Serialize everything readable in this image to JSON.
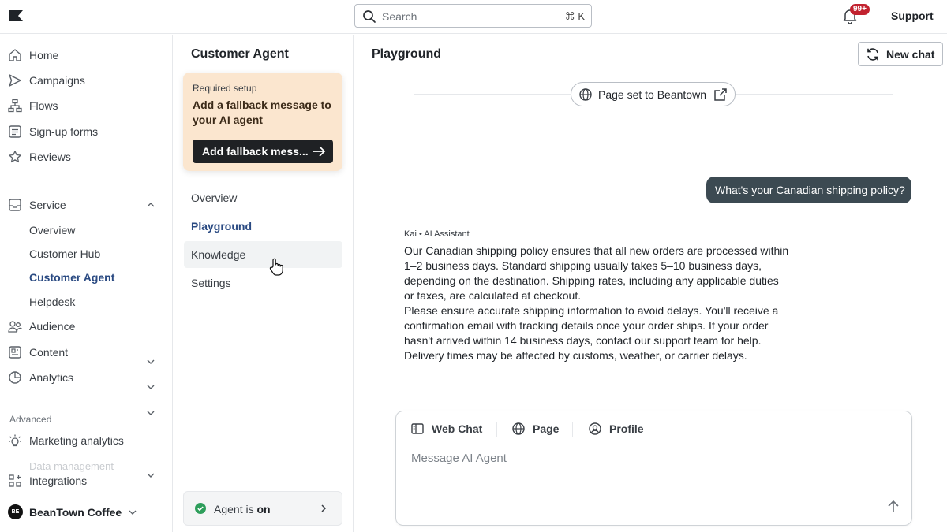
{
  "topbar": {
    "search_placeholder": "Search",
    "search_shortcut": "⌘ K",
    "notifications_badge": "99+",
    "support_label": "Support"
  },
  "sidebar": {
    "items": [
      {
        "label": "Home",
        "icon": "home-icon"
      },
      {
        "label": "Campaigns",
        "icon": "send-icon"
      },
      {
        "label": "Flows",
        "icon": "flows-icon"
      },
      {
        "label": "Sign-up forms",
        "icon": "form-icon"
      },
      {
        "label": "Reviews",
        "icon": "star-icon"
      }
    ],
    "service": {
      "label": "Service",
      "expanded": true,
      "children": [
        "Overview",
        "Customer Hub",
        "Customer Agent",
        "Helpdesk"
      ],
      "active": "Customer Agent"
    },
    "collapsed_groups": [
      {
        "label": "Audience",
        "icon": "audience-icon"
      },
      {
        "label": "Content",
        "icon": "content-icon"
      },
      {
        "label": "Analytics",
        "icon": "analytics-icon"
      }
    ],
    "advanced_section": "Advanced",
    "advanced_items": [
      {
        "label": "Marketing analytics",
        "icon": "bulb-icon"
      },
      {
        "label": "Data management",
        "icon": "data-icon"
      }
    ],
    "integrations": "Integrations",
    "account": {
      "initials": "BE",
      "name": "BeanTown Coffee"
    }
  },
  "agent_panel": {
    "title": "Customer Agent",
    "setup_card": {
      "kicker": "Required setup",
      "title": "Add a fallback message to your AI agent",
      "button": "Add fallback mess..."
    },
    "tabs": [
      "Overview",
      "Playground",
      "Knowledge",
      "Settings"
    ],
    "active_tab": "Playground",
    "status": {
      "prefix": "Agent is ",
      "state": "on"
    }
  },
  "main": {
    "title": "Playground",
    "new_chat": "New chat",
    "page_set": "Page set to Beantown",
    "user_message": "What's your Canadian shipping policy?",
    "assistant": {
      "meta": "Kai • AI Assistant",
      "paragraph1": "Our Canadian shipping policy ensures that all new orders are processed within 1–2 business days. Standard shipping usually takes 5–10 business days, depending on the destination. Shipping rates, including any applicable duties or taxes, are calculated at checkout.",
      "paragraph2": "Please ensure accurate shipping information to avoid delays. You'll receive a confirmation email with tracking details once your order ships. If your order hasn't arrived within 14 business days, contact our support team for help. Delivery times may be affected by customs, weather, or carrier delays."
    },
    "composer": {
      "tabs": [
        "Web Chat",
        "Page",
        "Profile"
      ],
      "placeholder": "Message AI Agent"
    }
  },
  "colors": {
    "accent": "#2a4a82",
    "setup_card_bg": "#fbe6cf",
    "user_bubble": "#3c4a52",
    "badge": "#c2222f",
    "status_ok": "#2e9e5b"
  }
}
